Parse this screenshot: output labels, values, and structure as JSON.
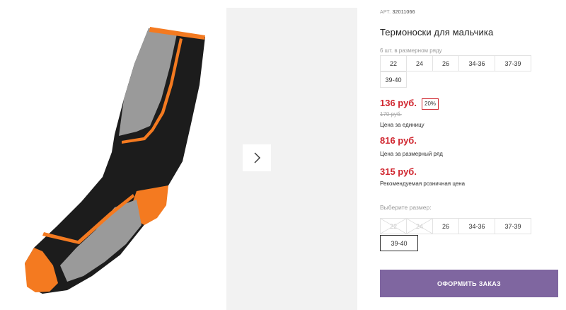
{
  "product": {
    "sku_label": "АРТ.",
    "sku": "32011066",
    "title": "Термоноски для мальчика"
  },
  "size_range": {
    "note": "6 шт. в размерном ряду",
    "sizes": [
      "22",
      "24",
      "26",
      "34-36",
      "37-39",
      "39-40"
    ]
  },
  "pricing": {
    "unit_price": "136 руб.",
    "discount": "20%",
    "old_price": "170 руб.",
    "unit_caption": "Цена за единицу",
    "range_price": "816 руб.",
    "range_caption": "Цена за размерный ряд",
    "retail_price": "315 руб.",
    "retail_caption": "Рекомендуемая розничная цена"
  },
  "size_select": {
    "label": "Выберите размер:",
    "options": [
      {
        "label": "22",
        "available": false
      },
      {
        "label": "24",
        "available": false
      },
      {
        "label": "26",
        "available": true
      },
      {
        "label": "34-36",
        "available": true
      },
      {
        "label": "37-39",
        "available": true
      },
      {
        "label": "39-40",
        "available": true,
        "selected": true
      }
    ]
  },
  "actions": {
    "order_button": "ОФОРМИТЬ ЗАКАЗ",
    "next_icon": "chevron-right-icon"
  },
  "colors": {
    "price_red": "#d0262f",
    "button_purple": "#7f66a0",
    "sock_black": "#1c1c1c",
    "sock_grey": "#9a9a9a",
    "sock_orange": "#f47a20"
  }
}
